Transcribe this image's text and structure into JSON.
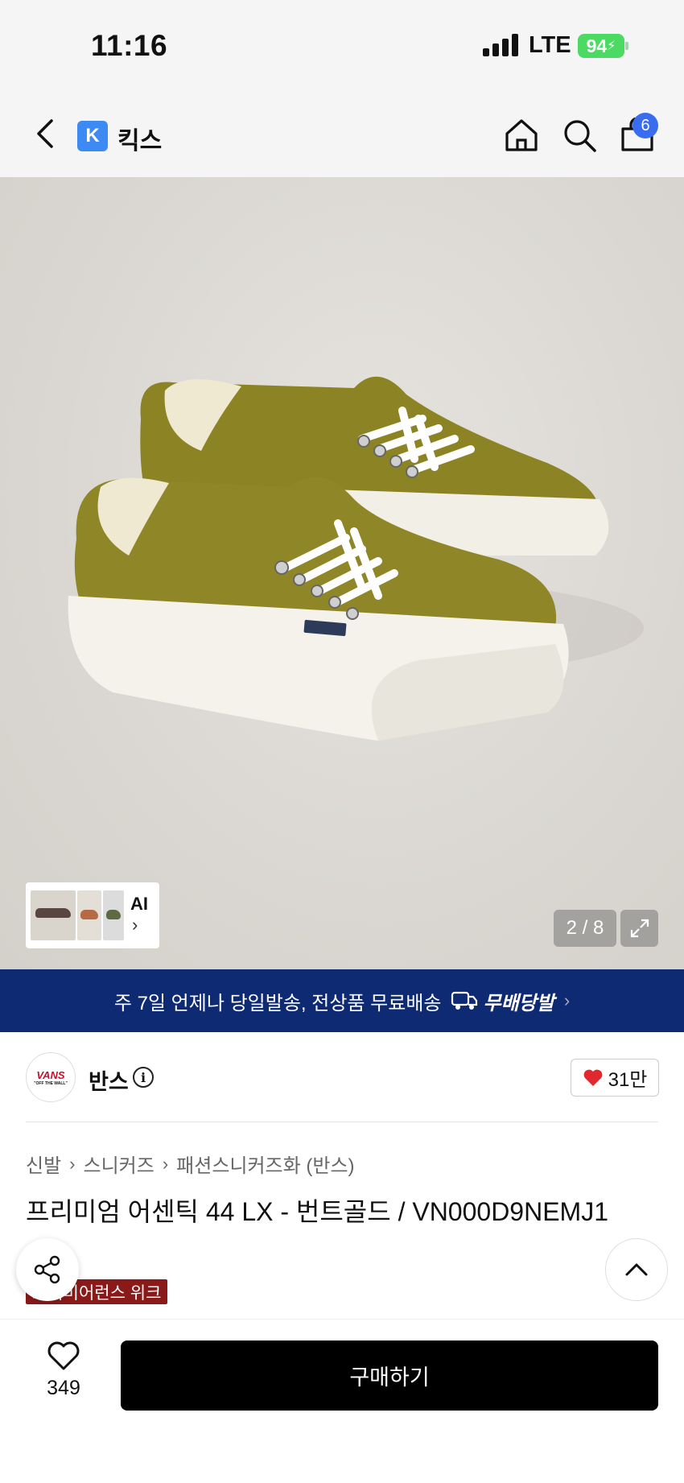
{
  "status_bar": {
    "time": "11:16",
    "network": "LTE",
    "battery": "94"
  },
  "header": {
    "store_logo": "K",
    "store_name": "킥스",
    "cart_count": "6"
  },
  "gallery": {
    "ai_label": "AI",
    "counter": "2 / 8"
  },
  "banner": {
    "text": "주 7일 언제나 당일발송, 전상품 무료배송",
    "service": "무배당발"
  },
  "brand": {
    "logo_text": "VANS",
    "logo_sub": "\"OFF THE WALL\"",
    "name": "반스",
    "likes": "31만"
  },
  "breadcrumb": [
    "신발",
    "스니커즈",
    "패션스니커즈화 (반스)"
  ],
  "product": {
    "title": "프리미엄 어센틱 44 LX - 번트골드 / VN000D9NEMJ1",
    "tag": "프리미어런스 위크"
  },
  "bottom": {
    "wish_count": "349",
    "buy_label": "구매하기"
  },
  "colors": {
    "banner": "#0d2a73",
    "cart_badge": "#3a6cf0",
    "tag": "#8a1a1a",
    "heart": "#e0282e",
    "shoe": "#8c8424"
  }
}
